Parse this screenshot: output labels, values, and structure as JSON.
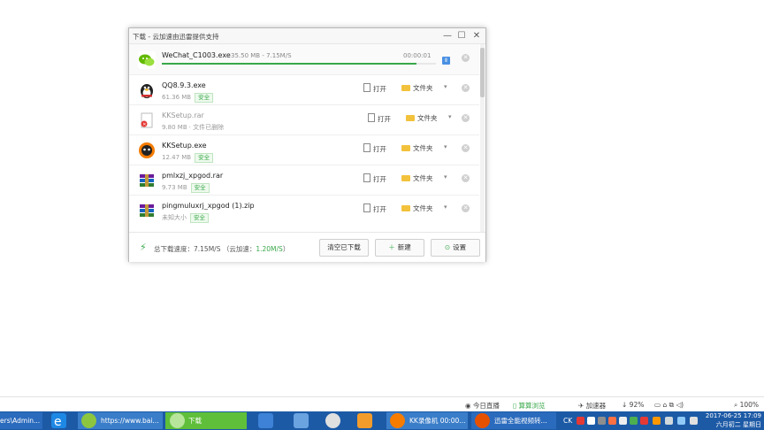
{
  "dialog": {
    "title": "下载 - 云加速由迅雷提供支持",
    "window_buttons": {
      "minimize": "—",
      "maximize": "☐",
      "close": "✕"
    },
    "active": {
      "name": "WeChat_C1003.exe",
      "progress_text": "35.50 MB - 7.15M/S",
      "elapsed": "00:00:01",
      "progress_fraction": 0.93
    },
    "files": [
      {
        "name": "QQ8.9.3.exe",
        "size": "61.36 MB",
        "badge": "安全",
        "deleted": false,
        "icon": "penguin-icon"
      },
      {
        "name": "KKSetup.rar",
        "size": "9.80 MB",
        "badge": "",
        "deleted": true,
        "deleted_text": "· 文件已删除",
        "icon": "broken-file-icon"
      },
      {
        "name": "KKSetup.exe",
        "size": "12.47 MB",
        "badge": "安全",
        "deleted": false,
        "icon": "kk-icon"
      },
      {
        "name": "pmlxzj_xpgod.rar",
        "size": "9.73 MB",
        "badge": "安全",
        "deleted": false,
        "icon": "winrar-icon"
      },
      {
        "name": "pingmuluxrj_xpgod (1).zip",
        "size": "未知大小",
        "badge": "安全",
        "deleted": false,
        "icon": "winrar-icon"
      }
    ],
    "actions": {
      "open": "打开",
      "folder": "文件夹",
      "caret": "▾",
      "remove": "✕"
    },
    "footer": {
      "speed_prefix": "总下载速度：7.15M/S （云加速：",
      "cloud_speed": "1.20M/S",
      "speed_suffix": "）",
      "clear_label": "清空已下载",
      "new_label": "新建",
      "settings_label": "设置"
    }
  },
  "statusbar": {
    "live": "今日直播",
    "browse": "算算浏览",
    "accelerator": "加速器",
    "download_pct": "92%",
    "zoom": "100%"
  },
  "taskbar": {
    "items": [
      {
        "label": "ers\\Admin..."
      },
      {
        "label": "https://www.bai..."
      },
      {
        "label": "下载"
      },
      {
        "label": "KK录像机 00:00..."
      },
      {
        "label": "迅雷全能视频转..."
      }
    ],
    "ime": "CK",
    "clock_time": "2017-06-25 17:09",
    "clock_date": "六月初二 星期日"
  },
  "colors": {
    "accent_green": "#3aa84a",
    "taskbar_blue": "#1d5aa6"
  }
}
